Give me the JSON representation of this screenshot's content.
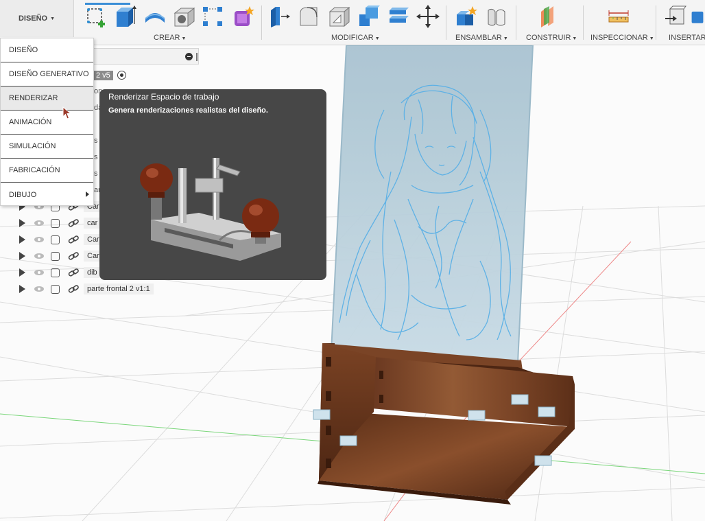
{
  "toolbar": {
    "workspace_label": "DISEÑO",
    "groups": [
      {
        "label": "CREAR"
      },
      {
        "label": "MODIFICAR"
      },
      {
        "label": "ENSAMBLAR"
      },
      {
        "label": "CONSTRUIR"
      },
      {
        "label": "INSPECCIONAR"
      },
      {
        "label": "INSERTAR"
      }
    ],
    "icons": {
      "sketch": "create-sketch-icon",
      "extrude": "extrude-icon",
      "revolve": "revolve-icon",
      "hole": "hole-icon",
      "pattern": "pattern-icon",
      "form": "create-form-icon",
      "press_pull": "press-pull-icon",
      "fillet": "fillet-icon",
      "shell": "shell-icon",
      "combine": "combine-icon",
      "align": "align-icon",
      "move": "move-icon",
      "new_component": "new-component-icon",
      "joint": "joint-icon",
      "plane": "offset-plane-icon",
      "measure": "measure-icon",
      "insert_derive": "insert-derive-icon",
      "insert_more": "insert-icon"
    }
  },
  "ws_menu": {
    "items": [
      {
        "label": "DISEÑO"
      },
      {
        "label": "DISEÑO GENERATIVO"
      },
      {
        "label": "RENDERIZAR"
      },
      {
        "label": "ANIMACIÓN"
      },
      {
        "label": "SIMULACIÓN"
      },
      {
        "label": "FABRICACIÓN"
      },
      {
        "label": "DIBUJO"
      }
    ],
    "hovered": "RENDERIZAR"
  },
  "browser": {
    "root_label": "2 v5",
    "clipped_labels": [
      "on",
      "da",
      "s",
      "s",
      "s",
      "ar"
    ],
    "rows": [
      {
        "label": "Car"
      },
      {
        "label": "car"
      },
      {
        "label": "Car"
      },
      {
        "label": "Car"
      },
      {
        "label": "dib"
      },
      {
        "label": "parte frontal 2 v1:1"
      }
    ]
  },
  "tooltip": {
    "title": "Renderizar Espacio de trabajo",
    "description": "Genera renderizaciones realistas del diseño.",
    "image": "hand-router-plane-image"
  },
  "colors": {
    "accent": "#3a8ed6",
    "tooltip_bg": "#474747",
    "wood": "#6b3a1e",
    "glass": "#b7cfdc",
    "engraving": "#5ab0e6",
    "grid": "#d8d8d8",
    "axis_green": "#6fd26f",
    "axis_red": "#e05050"
  }
}
